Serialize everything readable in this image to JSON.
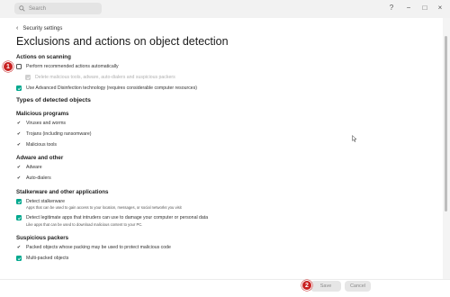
{
  "titlebar": {
    "search_placeholder": "Search",
    "help_label": "?",
    "minimize_label": "−",
    "maximize_label": "□",
    "close_label": "×"
  },
  "breadcrumb": {
    "back_label": "Security settings"
  },
  "page_title": "Exclusions and actions on object detection",
  "actions": {
    "heading": "Actions on scanning",
    "perform_recommended": {
      "label": "Perform recommended actions automatically",
      "checked": false
    },
    "delete_malicious": {
      "label": "Delete malicious tools, adware, auto-dialers and suspicious packers",
      "checked": true,
      "disabled": true
    },
    "advanced_disinfection": {
      "label": "Use Advanced Disinfection technology (requires considerable computer resources)",
      "checked": true
    }
  },
  "types_heading": "Types of detected objects",
  "malicious": {
    "heading": "Malicious programs",
    "items": [
      "Viruses and worms",
      "Trojans (including ransomware)",
      "Malicious tools"
    ]
  },
  "adware": {
    "heading": "Adware and other",
    "items": [
      "Adware",
      "Auto-dialers"
    ]
  },
  "stalkerware": {
    "heading": "Stalkerware and other applications",
    "detect_stalkerware": {
      "label": "Detect stalkerware",
      "desc": "Apps that can be used to gain access to your location, messages, or social networks you visit",
      "checked": true
    },
    "detect_legit": {
      "label": "Detect legitimate apps that intruders can use to damage your computer or personal data",
      "desc": "Like apps that can be used to download malicious content to your PC.",
      "checked": true
    }
  },
  "packers": {
    "heading": "Suspicious packers",
    "packed_label": "Packed objects whose packing may be used to protect malicious code",
    "multipacked": {
      "label": "Multi-packed objects",
      "checked": true
    }
  },
  "footer": {
    "save_label": "Save",
    "cancel_label": "Cancel"
  },
  "badges": {
    "badge1": "1",
    "badge2": "2"
  },
  "colors": {
    "accent": "#00a88e",
    "badge": "#c82020"
  }
}
